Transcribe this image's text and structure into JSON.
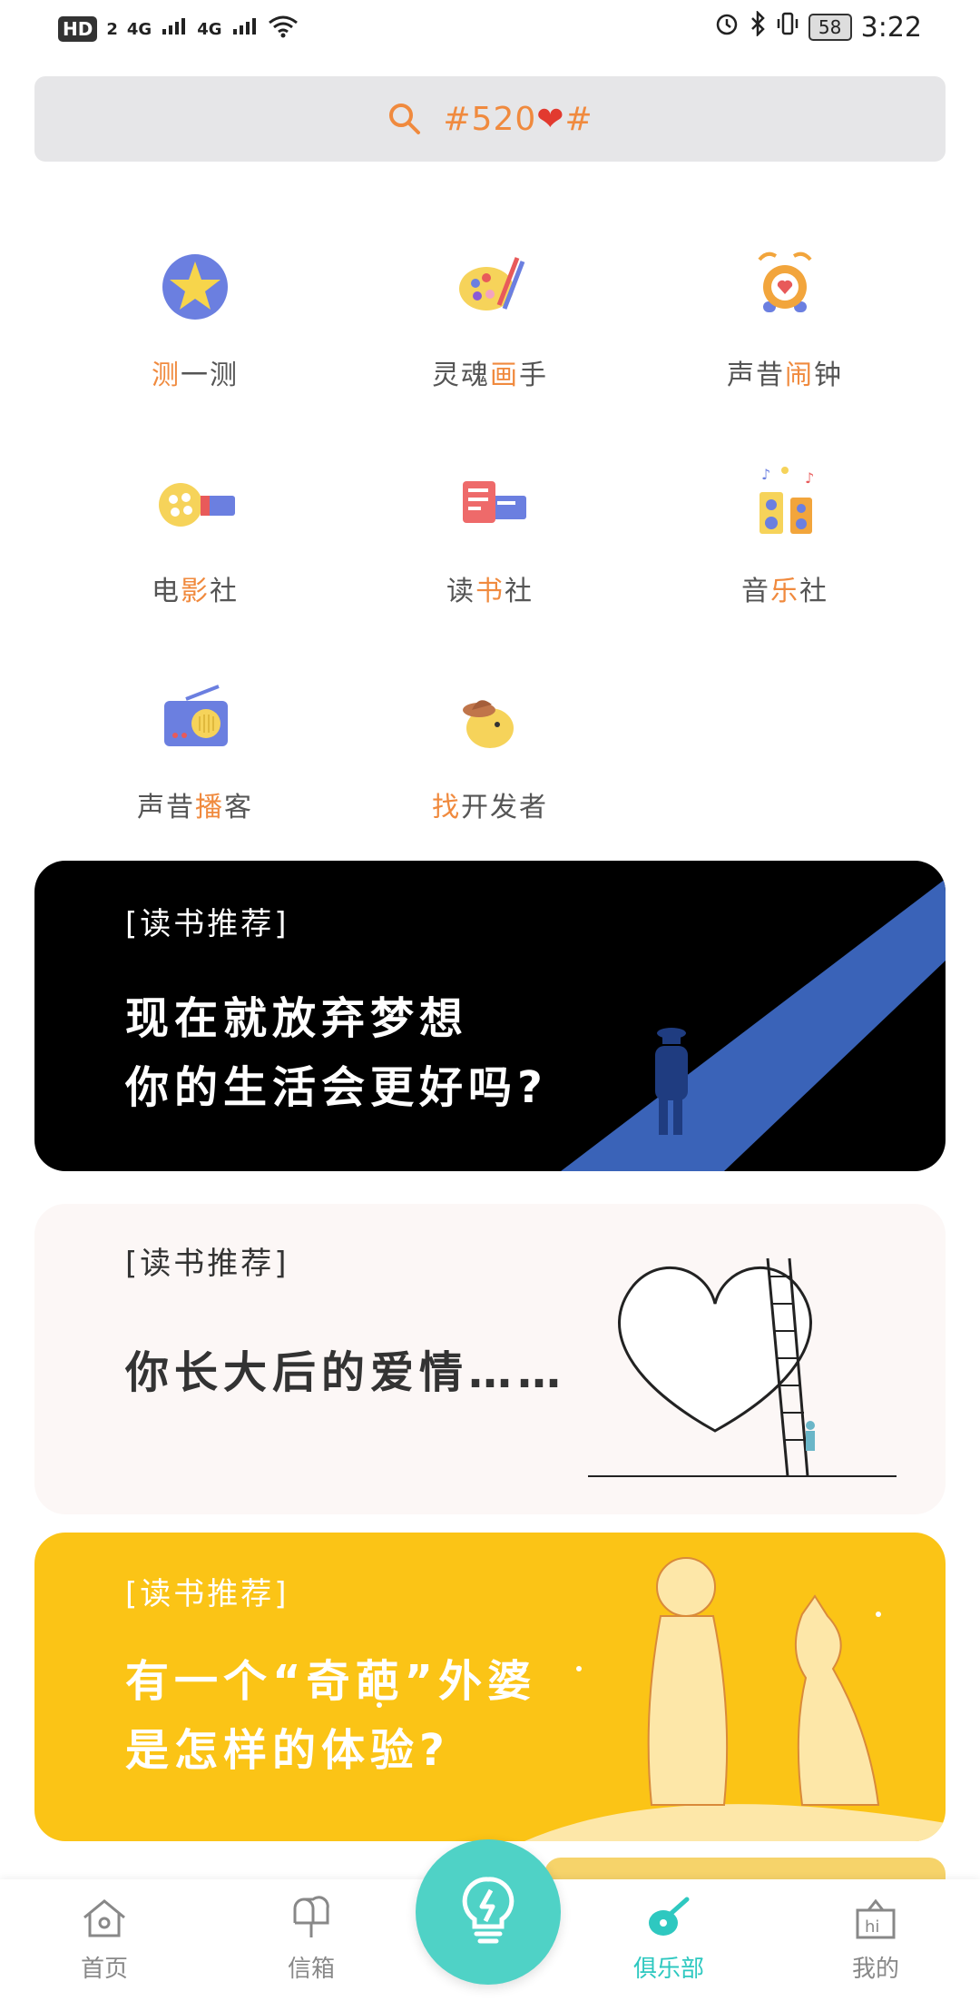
{
  "status_bar": {
    "hd_label": "HD",
    "sim_index": "2",
    "net1": "4G",
    "net2": "4G",
    "battery": "58",
    "time": "3:22"
  },
  "search": {
    "text_prefix": "#520",
    "heart": "❤",
    "text_suffix": "#"
  },
  "features": [
    {
      "pre": "",
      "hl": "测",
      "post": "一测",
      "icon": "star-icon"
    },
    {
      "pre": "灵魂",
      "hl": "画",
      "post": "手",
      "icon": "palette-icon"
    },
    {
      "pre": "声昔",
      "hl": "闹",
      "post": "钟",
      "icon": "alarm-clock-icon"
    },
    {
      "pre": "电",
      "hl": "影",
      "post": "社",
      "icon": "film-projector-icon"
    },
    {
      "pre": "读",
      "hl": "书",
      "post": "社",
      "icon": "book-icon"
    },
    {
      "pre": "音",
      "hl": "乐",
      "post": "社",
      "icon": "speaker-icon"
    },
    {
      "pre": "声昔",
      "hl": "播",
      "post": "客",
      "icon": "radio-icon"
    },
    {
      "pre": "",
      "hl": "找",
      "post": "开发者",
      "icon": "developer-mascot-icon"
    }
  ],
  "cards": [
    {
      "tag": "[读书推荐]",
      "line1": "现在就放弃梦想",
      "line2": "你的生活会更好吗?"
    },
    {
      "tag": "[读书推荐]",
      "line1": "你长大后的爱情……",
      "line2": ""
    },
    {
      "tag": "[读书推荐]",
      "line1": "有一个“奇葩”外婆",
      "line2": "是怎样的体验?"
    }
  ],
  "tabs": [
    {
      "label": "首页",
      "icon": "home-icon"
    },
    {
      "label": "信箱",
      "icon": "mailbox-icon"
    },
    {
      "label": "俱乐部",
      "icon": "guitar-icon",
      "active": true
    },
    {
      "label": "我的",
      "icon": "hi-box-icon"
    }
  ],
  "colors": {
    "accent": "#f08a3e",
    "teal": "#2ec8c0",
    "card_black": "#000000",
    "card_yellow": "#fbc416"
  }
}
